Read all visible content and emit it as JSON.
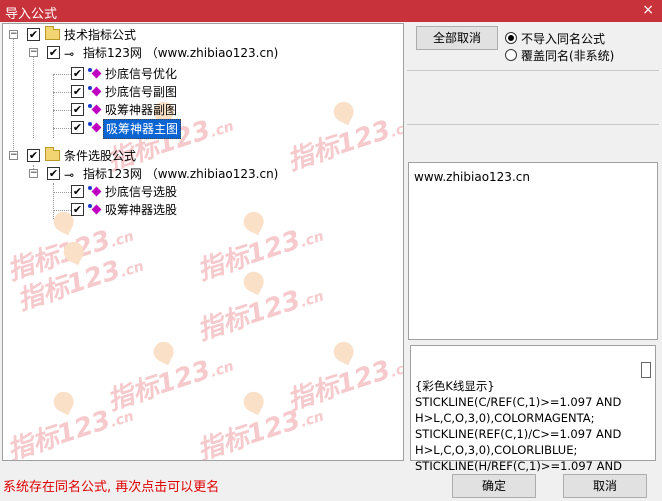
{
  "window": {
    "title": "导入公式",
    "close_glyph": "×"
  },
  "tree": {
    "watermark": {
      "main": "指标123",
      "suffix": ".cn"
    },
    "nodes": [
      {
        "label": "技术指标公式"
      },
      {
        "label": "指标123网 （www.zhibiao123.cn)"
      },
      {
        "label": "抄底信号优化"
      },
      {
        "label": "抄底信号副图"
      },
      {
        "label": "吸筹神器副图"
      },
      {
        "label": "吸筹神器主图"
      },
      {
        "label": "条件选股公式"
      },
      {
        "label": "指标123网 （www.zhibiao123.cn)"
      },
      {
        "label": "抄底信号选股"
      },
      {
        "label": "吸筹神器选股"
      }
    ],
    "expander_open": "−",
    "check_glyph": "✔",
    "key_glyph": "⊸"
  },
  "actions": {
    "cancel_all": "全部取消",
    "option_skip": "不导入同名公式",
    "option_overwrite": "覆盖同名(非系统)",
    "selected_option": "skip"
  },
  "description": "www.zhibiao123.cn",
  "code_preview": {
    "lines": [
      "{彩色K线显示}",
      "STICKLINE(C/REF(C,1)>=1.097 AND",
      "H>L,C,O,3,0),COLORMAGENTA;",
      "STICKLINE(REF(C,1)/C>=1.097 AND",
      "H>L,C,O,3,0),COLORLIBLUE;",
      "STICKLINE(H/REF(C,1)>=1.097 AND"
    ]
  },
  "status_message": "系统存在同名公式, 再次点击可以更名",
  "footer": {
    "ok": "确定",
    "cancel": "取消"
  },
  "colors": {
    "title_bar": "#c8323b",
    "status_text": "#e00000",
    "selection": "#0a64d2"
  }
}
